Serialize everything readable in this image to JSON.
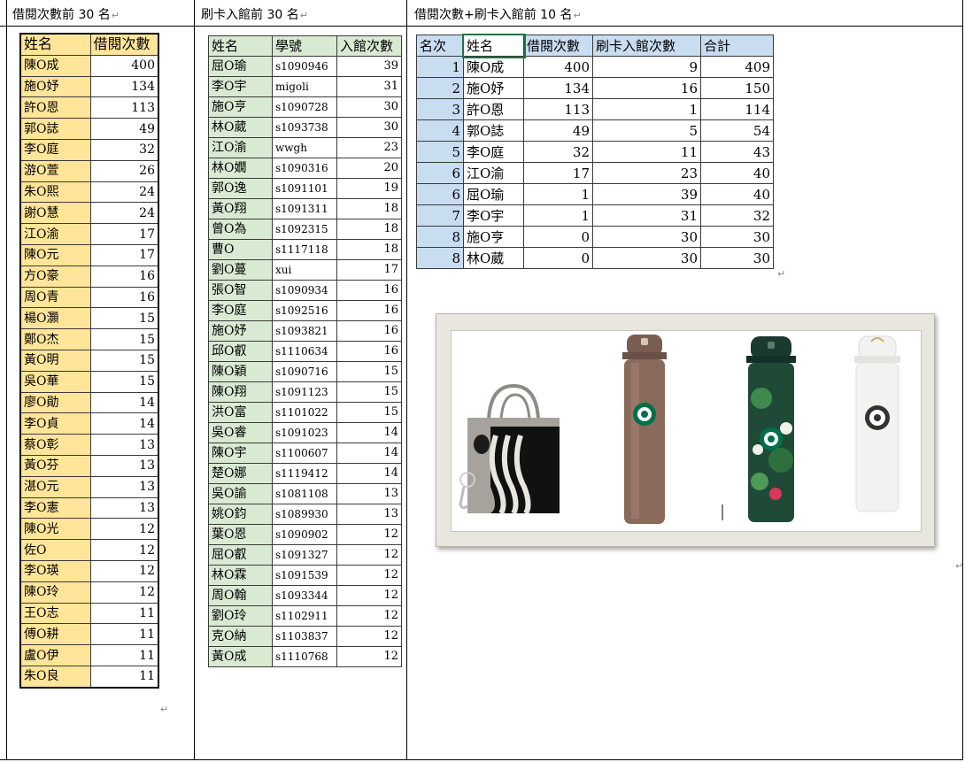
{
  "columns": [
    {
      "heading": "借閱次數前 30 名"
    },
    {
      "heading": "刷卡入館前 30 名"
    },
    {
      "heading": "借閱次數+刷卡入館前 10 名"
    }
  ],
  "borrow_table": {
    "headers": [
      "姓名",
      "借閱次數"
    ],
    "rows": [
      [
        "陳O成",
        "400"
      ],
      [
        "施O妤",
        "134"
      ],
      [
        "許O恩",
        "113"
      ],
      [
        "郭O誌",
        "49"
      ],
      [
        "李O庭",
        "32"
      ],
      [
        "游O萱",
        "26"
      ],
      [
        "朱O熙",
        "24"
      ],
      [
        "謝O慧",
        "24"
      ],
      [
        "江O渝",
        "17"
      ],
      [
        "陳O元",
        "17"
      ],
      [
        "方O豪",
        "16"
      ],
      [
        "周O青",
        "16"
      ],
      [
        "楊O灝",
        "15"
      ],
      [
        "鄭O杰",
        "15"
      ],
      [
        "黃O明",
        "15"
      ],
      [
        "吳O華",
        "15"
      ],
      [
        "廖O勛",
        "14"
      ],
      [
        "李O貞",
        "14"
      ],
      [
        "蔡O彰",
        "13"
      ],
      [
        "黃O芬",
        "13"
      ],
      [
        "湛O元",
        "13"
      ],
      [
        "李O憲",
        "13"
      ],
      [
        "陳O光",
        "12"
      ],
      [
        "佐O",
        "12"
      ],
      [
        "李O瑛",
        "12"
      ],
      [
        "陳O玲",
        "12"
      ],
      [
        "王O志",
        "11"
      ],
      [
        "傅O耕",
        "11"
      ],
      [
        "盧O伊",
        "11"
      ],
      [
        "朱O良",
        "11"
      ]
    ]
  },
  "entry_table": {
    "headers": [
      "姓名",
      "學號",
      "入館次數"
    ],
    "rows": [
      [
        "屈O瑜",
        "s1090946",
        "39"
      ],
      [
        "李O宇",
        "migoli",
        "31"
      ],
      [
        "施O亨",
        "s1090728",
        "30"
      ],
      [
        "林O葳",
        "s1093738",
        "30"
      ],
      [
        "江O渝",
        "wwgh",
        "23"
      ],
      [
        "林O嫺",
        "s1090316",
        "20"
      ],
      [
        "郭O逸",
        "s1091101",
        "19"
      ],
      [
        "黃O翔",
        "s1091311",
        "18"
      ],
      [
        "曾O為",
        "s1092315",
        "18"
      ],
      [
        "曹O",
        "s1117118",
        "18"
      ],
      [
        "劉O蔓",
        "xui",
        "17"
      ],
      [
        "張O智",
        "s1090934",
        "16"
      ],
      [
        "李O庭",
        "s1092516",
        "16"
      ],
      [
        "施O妤",
        "s1093821",
        "16"
      ],
      [
        "邱O叡",
        "s1110634",
        "16"
      ],
      [
        "陳O穎",
        "s1090716",
        "15"
      ],
      [
        "陳O翔",
        "s1091123",
        "15"
      ],
      [
        "洪O富",
        "s1101022",
        "15"
      ],
      [
        "吳O睿",
        "s1091023",
        "14"
      ],
      [
        "陳O宇",
        "s1100607",
        "14"
      ],
      [
        "楚O娜",
        "s1119412",
        "14"
      ],
      [
        "吳O諭",
        "s1081108",
        "13"
      ],
      [
        "姚O鈞",
        "s1089930",
        "13"
      ],
      [
        "葉O恩",
        "s1090902",
        "12"
      ],
      [
        "屈O叡",
        "s1091327",
        "12"
      ],
      [
        "林O霖",
        "s1091539",
        "12"
      ],
      [
        "周O翰",
        "s1093344",
        "12"
      ],
      [
        "劉O玲",
        "s1102911",
        "12"
      ],
      [
        "克O納",
        "s1103837",
        "12"
      ],
      [
        "黃O成",
        "s1110768",
        "12"
      ]
    ]
  },
  "combined_table": {
    "headers": [
      "名次",
      "姓名",
      "借閱次數",
      "刷卡入館次數",
      "合計"
    ],
    "rows": [
      [
        "1",
        "陳O成",
        "400",
        "9",
        "409"
      ],
      [
        "2",
        "施O妤",
        "134",
        "16",
        "150"
      ],
      [
        "3",
        "許O恩",
        "113",
        "1",
        "114"
      ],
      [
        "4",
        "郭O誌",
        "49",
        "5",
        "54"
      ],
      [
        "5",
        "李O庭",
        "32",
        "11",
        "43"
      ],
      [
        "6",
        "江O渝",
        "17",
        "23",
        "40"
      ],
      [
        "6",
        "屈O瑜",
        "1",
        "39",
        "40"
      ],
      [
        "7",
        "李O宇",
        "1",
        "31",
        "32"
      ],
      [
        "8",
        "施O亨",
        "0",
        "30",
        "30"
      ],
      [
        "8",
        "林O葳",
        "0",
        "30",
        "30"
      ]
    ]
  },
  "prizes": {
    "items": [
      "tote-bag",
      "bronze-tumbler",
      "floral-tumbler",
      "white-tumbler"
    ],
    "colors": {
      "bag": "#a7a39c",
      "bronze": "#8a6a5b",
      "floral": "#1f4a37",
      "white": "#f2f2f0",
      "logo": "#00704a"
    }
  },
  "paragraph_mark": "↵"
}
